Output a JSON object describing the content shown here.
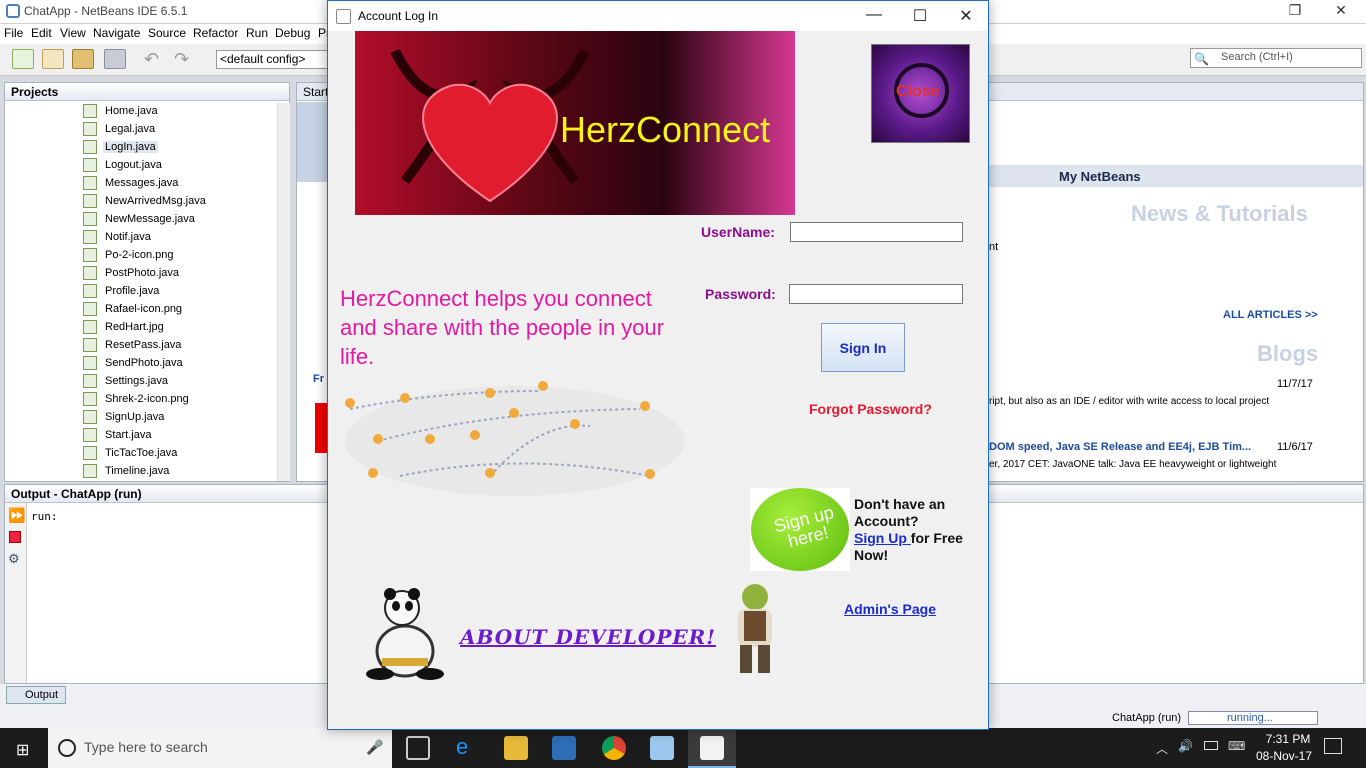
{
  "ide": {
    "title": "ChatApp - NetBeans IDE 6.5.1",
    "menu": [
      "File",
      "Edit",
      "View",
      "Navigate",
      "Source",
      "Refactor",
      "Run",
      "Debug",
      "Pr"
    ],
    "config": "<default config>",
    "search_placeholder": "Search (Ctrl+I)",
    "projects_title": "Projects",
    "files": [
      "Home.java",
      "Legal.java",
      "LogIn.java",
      "Logout.java",
      "Messages.java",
      "NewArrivedMsg.java",
      "NewMessage.java",
      "Notif.java",
      "Po-2-icon.png",
      "PostPhoto.java",
      "Profile.java",
      "Rafael-icon.png",
      "RedHart.jpg",
      "ResetPass.java",
      "SendPhoto.java",
      "Settings.java",
      "Shrek-2-icon.png",
      "SignUp.java",
      "Start.java",
      "TicTacToe.java",
      "Timeline.java"
    ],
    "selected_file": "LogIn.java",
    "editor_tab": "Start",
    "editor_fragment": "Fr",
    "my_netbeans": "My NetBeans",
    "news_heading": "News & Tutorials",
    "news_fragment": "nt",
    "all_articles": "ALL ARTICLES >>",
    "blogs_heading": "Blogs",
    "blog1_date": "11/7/17",
    "blog1_text": "ript, but also as an IDE / editor with write access to local project",
    "blog2_title": "DOM speed, Java SE Release and EE4j, EJB Tim...",
    "blog2_date": "11/6/17",
    "blog2_text": "er, 2017 CET: JavaONE talk: Java EE heavyweight or lightweight",
    "output_title": "Output - ChatApp (run)",
    "output_text": "run:",
    "output_tab": "Output",
    "status_project": "ChatApp (run)",
    "status_running": "running..."
  },
  "taskbar": {
    "search_placeholder": "Type here to search",
    "time": "7:31 PM",
    "date": "08-Nov-17"
  },
  "dialog": {
    "title": "Account Log In",
    "brand": "HerzConnect",
    "close_label": "Close",
    "username_label": "UserName:",
    "password_label": "Password:",
    "signin_label": "Sign In",
    "forgot_label": "Forgot Password?",
    "tagline": "HerzConnect helps you connect and share with the people in your life.",
    "signup_badge": "Sign up here!",
    "dont_have": "Don't have an Account?",
    "signup_link": "Sign Up ",
    "for_free": "for Free Now!",
    "admin_link": "Admin's Page",
    "about_link": "ABOUT DEVELOPER!",
    "colors": {
      "label": "#8b0e8b",
      "link": "#1a2bd1",
      "forgot": "#e41b32",
      "tagline": "#e11aa2",
      "about": "#6c1acb",
      "brand": "#f5f316"
    }
  }
}
